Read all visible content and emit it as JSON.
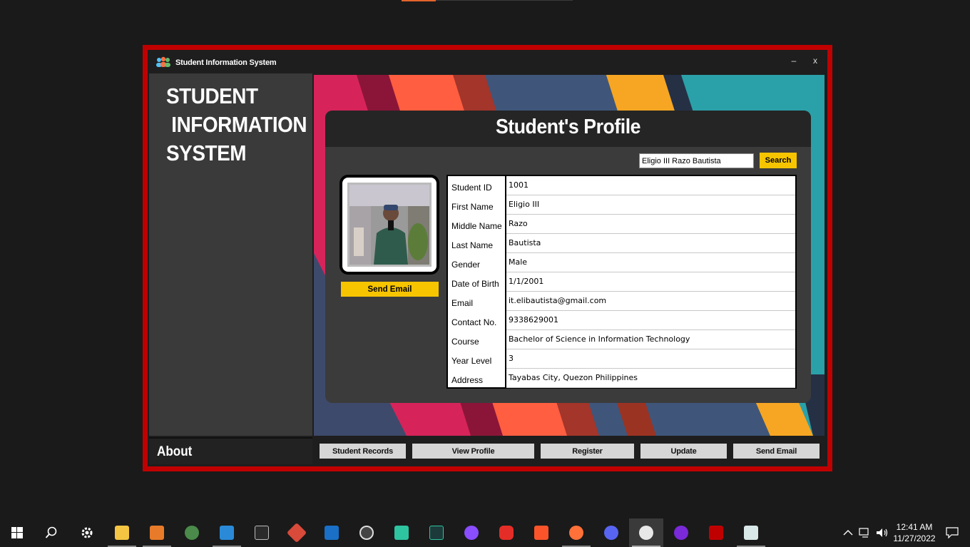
{
  "window": {
    "title": "Student Information System",
    "minimize_label": "–",
    "close_label": "x"
  },
  "sidebar": {
    "title_lines": [
      "STUDENT",
      " INFORMATION",
      "SYSTEM"
    ],
    "about_label": "About"
  },
  "profile": {
    "heading": "Student's Profile",
    "search_value": "Eligio III Razo Bautista",
    "search_button": "Search",
    "send_email_button": "Send Email",
    "fields": [
      {
        "label": "Student ID",
        "value": "1001"
      },
      {
        "label": "First Name",
        "value": "Eligio III"
      },
      {
        "label": "Middle Name",
        "value": "Razo"
      },
      {
        "label": "Last Name",
        "value": "Bautista"
      },
      {
        "label": "Gender",
        "value": "Male"
      },
      {
        "label": "Date of Birth",
        "value": "1/1/2001"
      },
      {
        "label": "Email",
        "value": "it.elibautista@gmail.com"
      },
      {
        "label": "Contact No.",
        "value": "9338629001"
      },
      {
        "label": "Course",
        "value": "Bachelor of Science in Information Technology"
      },
      {
        "label": "Year Level",
        "value": "3"
      },
      {
        "label": "Address",
        "value": "Tayabas City, Quezon Philippines"
      }
    ]
  },
  "nav": {
    "student_records": "Student Records",
    "view_profile": "View Profile",
    "register": "Register",
    "update": "Update",
    "send_email": "Send Email"
  },
  "taskbar": {
    "time": "12:41 AM",
    "date": "11/27/2022",
    "icons": [
      "windows-start",
      "search",
      "settings",
      "file-explorer",
      "sublime-text",
      "gitkraken",
      "vscode",
      "terminal",
      "git",
      "outlook",
      "obs",
      "app-green",
      "pycharm",
      "messenger",
      "youtube",
      "brave",
      "firefox",
      "discord",
      "java-app",
      "vpn-app",
      "filezilla",
      "notepad"
    ]
  },
  "colors": {
    "frame": "#c00000",
    "accent_yellow": "#f6c500",
    "panel": "#3b3b3b"
  }
}
